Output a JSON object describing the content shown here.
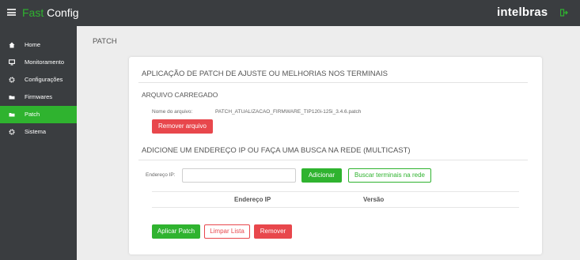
{
  "app": {
    "brand_part1": "Fast",
    "brand_part2": " Config",
    "logo": "intelbras"
  },
  "sidebar": {
    "items": [
      {
        "label": "Home",
        "icon": "home-icon",
        "active": false
      },
      {
        "label": "Monitoramento",
        "icon": "monitor-icon",
        "active": false
      },
      {
        "label": "Configurações",
        "icon": "gear-icon",
        "active": false
      },
      {
        "label": "Firmwares",
        "icon": "folder-icon",
        "active": false
      },
      {
        "label": "Patch",
        "icon": "folder-icon",
        "active": true
      },
      {
        "label": "Sistema",
        "icon": "gear-icon",
        "active": false
      }
    ]
  },
  "page": {
    "title": "PATCH"
  },
  "card": {
    "heading": "APLICAÇÃO DE PATCH DE AJUSTE OU MELHORIAS NOS TERMINAIS",
    "file_section": {
      "heading": "ARQUIVO CARREGADO",
      "file_name_label": "Nome do arquivo:",
      "file_name_value": "PATCH_ATUALIZACAO_FIRMWARE_TIP120i-125i_3.4.6.patch",
      "remove_file_button": "Remover arquivo"
    },
    "ip_section": {
      "heading": "ADICIONE UM ENDEREÇO IP OU FAÇA UMA BUSCA NA REDE (MULTICAST)",
      "ip_label": "Endereço IP:",
      "ip_value": "",
      "add_button": "Adicionar",
      "search_button": "Buscar terminais na rede"
    },
    "table": {
      "columns": [
        "Endereço IP",
        "Versão"
      ],
      "rows": []
    },
    "actions": {
      "apply": "Aplicar Patch",
      "clear": "Limpar Lista",
      "remove": "Remover"
    }
  },
  "colors": {
    "accent_green": "#2fb32f",
    "danger_red": "#e8474c",
    "sidebar_bg": "#3a3d40"
  }
}
